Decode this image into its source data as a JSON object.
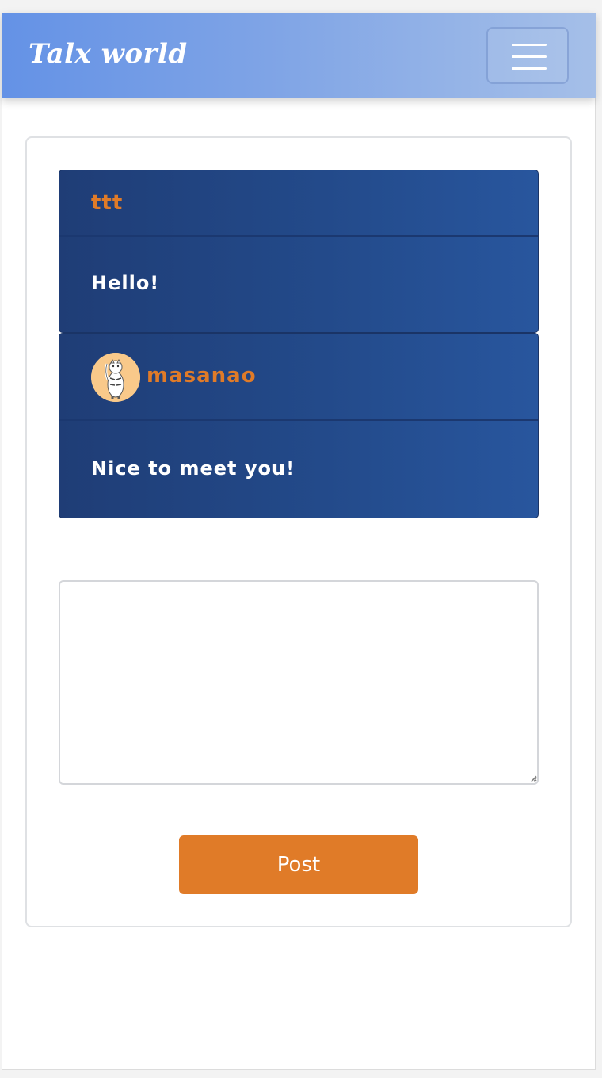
{
  "navbar": {
    "brand": "Talx world",
    "menu_icon": "hamburger-menu-icon"
  },
  "messages": [
    {
      "username": "ttt",
      "text": "Hello!",
      "has_avatar": false
    },
    {
      "username": "masanao",
      "text": "Nice to meet you!",
      "has_avatar": true,
      "avatar_icon": "tiger-avatar-icon"
    }
  ],
  "composer": {
    "value": "",
    "placeholder": "",
    "post_label": "Post"
  },
  "colors": {
    "navbar_gradient_start": "#6492e6",
    "navbar_gradient_end": "#a5bfe8",
    "message_bg": "#234a8a",
    "username_accent": "#e07b28",
    "post_button": "#e07b28"
  }
}
